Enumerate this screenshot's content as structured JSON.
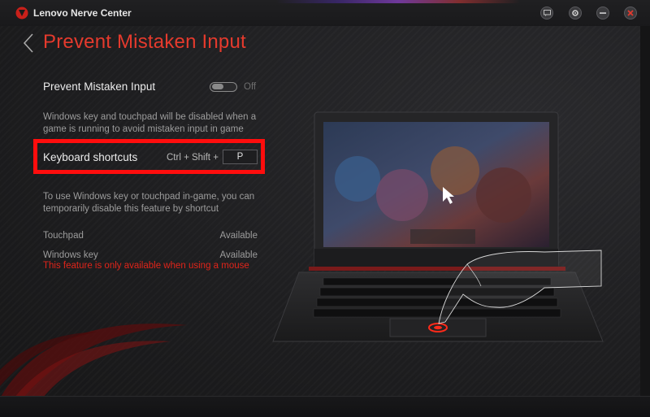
{
  "app": {
    "title": "Lenovo Nerve Center"
  },
  "titlebar": {
    "buttons": [
      {
        "name": "chat-icon",
        "label": ""
      },
      {
        "name": "settings-icon",
        "label": ""
      },
      {
        "name": "minimize-icon",
        "label": ""
      },
      {
        "name": "close-icon",
        "label": ""
      }
    ]
  },
  "header": {
    "title": "Prevent Mistaken Input"
  },
  "setting": {
    "label": "Prevent Mistaken Input",
    "toggle_state": "Off",
    "description_line1": "Windows key and touchpad will be disabled when a",
    "description_line2": "game is running to avoid mistaken input in game"
  },
  "shortcut": {
    "label": "Keyboard shortcuts",
    "combo": "Ctrl + Shift +",
    "key": "P",
    "hint_line1": "To use Windows key or touchpad in-game, you can",
    "hint_line2": "temporarily disable this feature by shortcut"
  },
  "status": {
    "rows": [
      {
        "label": "Touchpad",
        "value": "Available"
      },
      {
        "label": "Windows key",
        "value": "Available"
      }
    ],
    "warning": "This feature is only available when using a mouse"
  },
  "colors": {
    "accent": "#e53a2d",
    "highlight": "#ff0d0d",
    "warning": "#e0241a"
  }
}
